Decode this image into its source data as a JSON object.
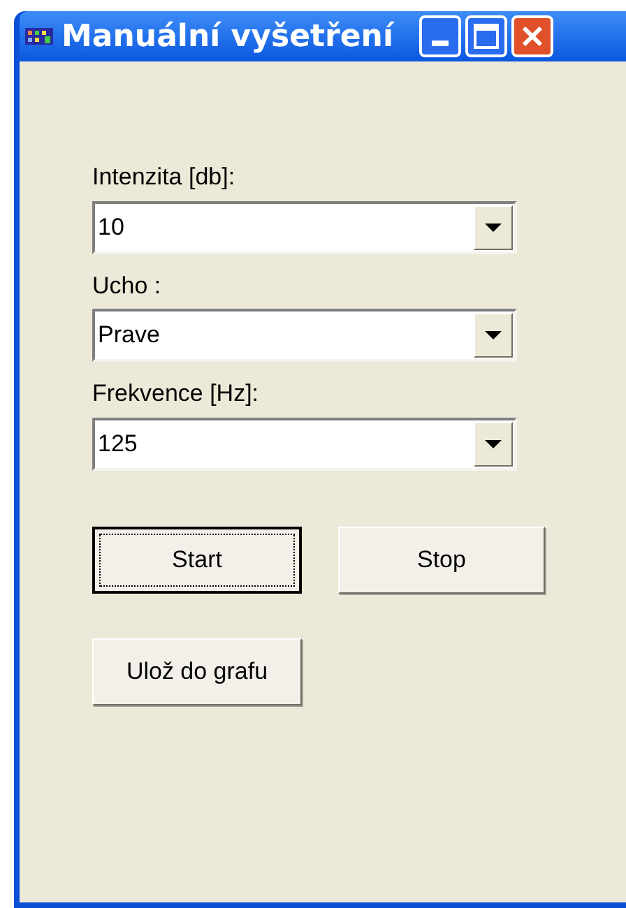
{
  "window": {
    "title": "Manuální vyšetření"
  },
  "fields": [
    {
      "label": "Intenzita [db]:",
      "value": "10"
    },
    {
      "label": "Ucho :",
      "value": "Prave"
    },
    {
      "label": "Frekvence [Hz]:",
      "value": "125"
    }
  ],
  "buttons": [
    {
      "label": "Start",
      "focused": true
    },
    {
      "label": "Stop",
      "focused": false
    },
    {
      "label": "Ulož do grafu",
      "focused": false
    }
  ]
}
